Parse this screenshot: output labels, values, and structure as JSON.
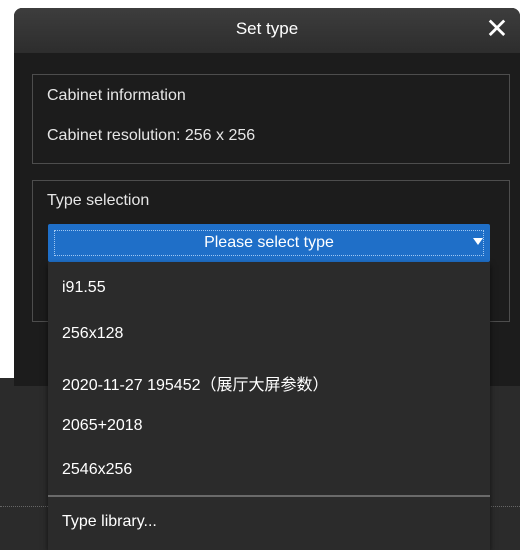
{
  "dialog": {
    "title": "Set type",
    "close_icon": "close-icon"
  },
  "cabinet": {
    "heading": "Cabinet information",
    "resolution": "Cabinet resolution: 256 x 256"
  },
  "type_selection": {
    "heading": "Type selection",
    "select_value": "Please select type",
    "options": [
      "i91.55",
      "256x128",
      "2020-11-27 195452（展厅大屏参数）",
      "2065+2018",
      "2546x256"
    ],
    "library_label": "Type library..."
  },
  "colors": {
    "accent": "#1f6fc8",
    "dialog_bg": "#1c1c1c",
    "menu_bg": "#2b2b2b"
  }
}
